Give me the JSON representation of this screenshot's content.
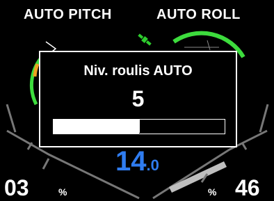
{
  "header": {
    "left_label": "AUTO PITCH",
    "right_label": "AUTO ROLL"
  },
  "status_icon": "satellite-icon",
  "left_gauge": {
    "value": "03",
    "unit": "%"
  },
  "right_gauge": {
    "value": "46",
    "unit": "%"
  },
  "center_readout": {
    "integer": "14",
    "decimal": ".0",
    "color": "#2f7cf0"
  },
  "popup": {
    "title": "Niv. roulis AUTO",
    "value": "5",
    "progress_fraction": 0.5
  },
  "colors": {
    "gauge_arc": "#3ddc3d",
    "gauge_arc_warn": "#f0a020",
    "background": "#000000",
    "text": "#ffffff",
    "accent_blue": "#2f7cf0",
    "satellite_green": "#2ecc2e"
  }
}
